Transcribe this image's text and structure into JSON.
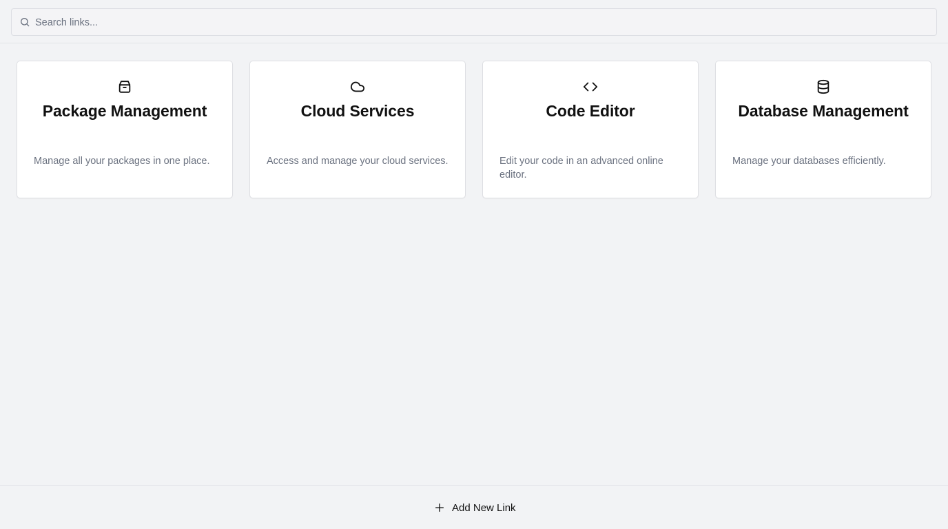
{
  "search": {
    "placeholder": "Search links...",
    "value": "",
    "icon": "search-icon"
  },
  "links": [
    {
      "title": "Package Management",
      "description": "Manage all your packages in one place.",
      "icon": "package-icon"
    },
    {
      "title": "Cloud Services",
      "description": "Access and manage your cloud services.",
      "icon": "cloud-icon"
    },
    {
      "title": "Code Editor",
      "description": "Edit your code in an advanced online editor.",
      "icon": "code-icon"
    },
    {
      "title": "Database Management",
      "description": "Manage your databases efficiently.",
      "icon": "database-icon"
    }
  ],
  "footer": {
    "add_label": "Add New Link",
    "add_icon": "plus-icon"
  },
  "colors": {
    "background": "#f2f3f5",
    "card": "#ffffff",
    "text": "#111111",
    "muted_text": "#6b7280",
    "border": "#dedfe3"
  }
}
